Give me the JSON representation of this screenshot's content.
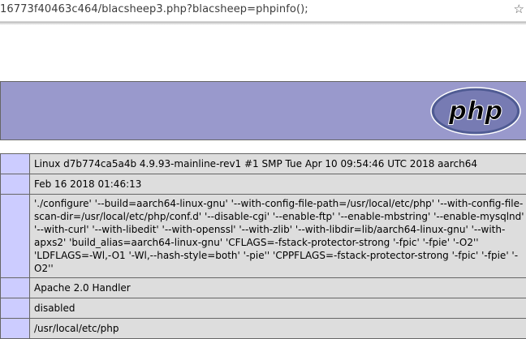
{
  "browser": {
    "url": "16773f40463c464/blacsheep3.php?blacsheep=phpinfo();",
    "bookmark_icon": "star-icon"
  },
  "header": {
    "logo_text": "php",
    "colors": {
      "header_bg": "#9999cc",
      "key_cell": "#ccccff",
      "value_cell": "#dddddd",
      "logo": "#777bb3"
    }
  },
  "rows": [
    {
      "value": "Linux d7b774ca5a4b 4.9.93-mainline-rev1 #1 SMP Tue Apr 10 09:54:46 UTC 2018 aarch64"
    },
    {
      "value": "Feb 16 2018 01:46:13"
    },
    {
      "value": "'./configure' '--build=aarch64-linux-gnu' '--with-config-file-path=/usr/local/etc/php' '--with-config-file-scan-dir=/usr/local/etc/php/conf.d' '--disable-cgi' '--enable-ftp' '--enable-mbstring' '--enable-mysqlnd' '--with-curl' '--with-libedit' '--with-openssl' '--with-zlib' '--with-libdir=lib/aarch64-linux-gnu' '--with-apxs2' 'build_alias=aarch64-linux-gnu' 'CFLAGS=-fstack-protector-strong '-fpic' '-fpie' '-O2'' 'LDFLAGS=-Wl,-O1 '-Wl,--hash-style=both' '-pie'' 'CPPFLAGS=-fstack-protector-strong '-fpic' '-fpie' '-O2''"
    },
    {
      "value": "Apache 2.0 Handler"
    },
    {
      "value": "disabled"
    },
    {
      "value": "/usr/local/etc/php"
    }
  ]
}
